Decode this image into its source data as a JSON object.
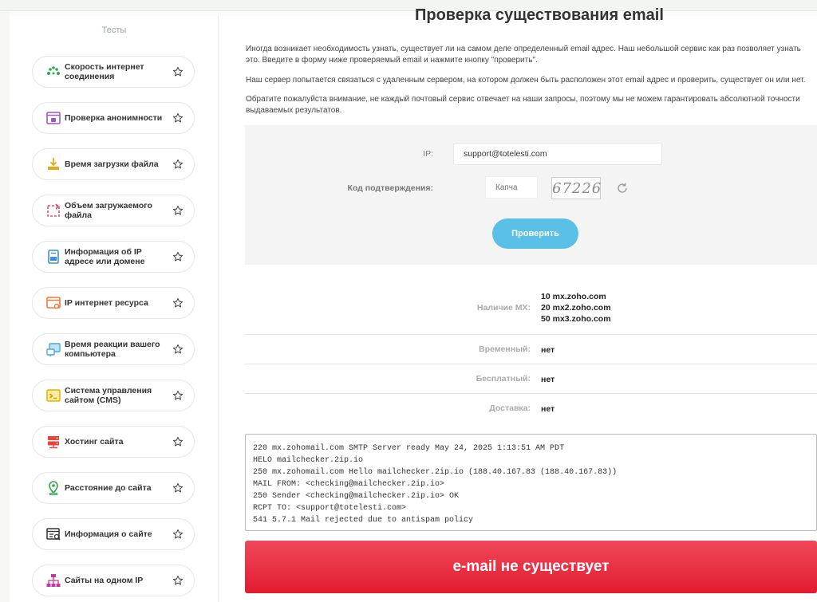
{
  "sidebar": {
    "title": "Тесты",
    "items": [
      {
        "label": "Скорость интернет соединения",
        "icon": "speed-dots-icon"
      },
      {
        "label": "Проверка анонимности",
        "icon": "anonymity-window-icon"
      },
      {
        "label": "Время загрузки файла",
        "icon": "download-icon"
      },
      {
        "label": "Объем загружаемого файла",
        "icon": "file-size-icon"
      },
      {
        "label": "Информация об IP адресе или домене",
        "icon": "ip-info-icon"
      },
      {
        "label": "IP интернет ресурса",
        "icon": "resource-ip-icon"
      },
      {
        "label": "Время реакции вашего компьютера",
        "icon": "computer-reaction-icon"
      },
      {
        "label": "Система управления сайтом (CMS)",
        "icon": "cms-terminal-icon"
      },
      {
        "label": "Хостинг сайта",
        "icon": "hosting-server-icon"
      },
      {
        "label": "Расстояние до сайта",
        "icon": "location-pin-icon"
      },
      {
        "label": "Информация о сайте",
        "icon": "site-info-icon"
      },
      {
        "label": "Сайты на одном IP",
        "icon": "network-tree-icon"
      }
    ]
  },
  "main": {
    "title": "Проверка существования email",
    "paragraphs": [
      "Иногда возникает необходимость узнать, существует ли на самом деле определенный email адрес. Наш небольшой сервис как раз позволяет узнать это. Введите в форму ниже проверяемый email и нажмите кнопку \"проверить\".",
      "Наш сервер попытается связаться с удаленным сервером, на котором должен быть расположен этот email адрес и проверить, существует он или нет.",
      "Обратите пожалуйста внимание, не каждый почтовый сервис отвечает на наши запросы, поэтому мы не можем гарантировать абсолютной точности выдаваемых результатов."
    ]
  },
  "form": {
    "ip_label": "IP:",
    "ip_value": "support@totelesti.com",
    "captcha_label": "Код подтверждения:",
    "captcha_placeholder": "Капча",
    "captcha_text": "67226",
    "submit_label": "Проверить"
  },
  "results": {
    "mx_label": "Наличие MX:",
    "mx_records": [
      {
        "priority": "10",
        "host": "mx.zoho.com"
      },
      {
        "priority": "20",
        "host": "mx2.zoho.com"
      },
      {
        "priority": "50",
        "host": "mx3.zoho.com"
      }
    ],
    "temporary_label": "Временный:",
    "temporary_value": "нет",
    "free_label": "Бесплатный:",
    "free_value": "нет",
    "delivery_label": "Доставка:",
    "delivery_value": "нет"
  },
  "smtp_log": [
    "220 mx.zohomail.com SMTP Server ready May 24, 2025 1:13:51 AM PDT",
    "HELO mailchecker.2ip.io",
    "250 mx.zohomail.com Hello mailchecker.2ip.io (188.40.167.83 (188.40.167.83))",
    "MAIL FROM: <checking@mailchecker.2ip.io>",
    "250 Sender <checking@mailchecker.2ip.io> OK",
    "RCPT TO: <support@totelesti.com>",
    "541 5.7.1 Mail rejected due to antispam policy"
  ],
  "verdict": "e-mail не существует",
  "colors": {
    "accent": "#5bc0e7",
    "error": "#e8283b"
  }
}
